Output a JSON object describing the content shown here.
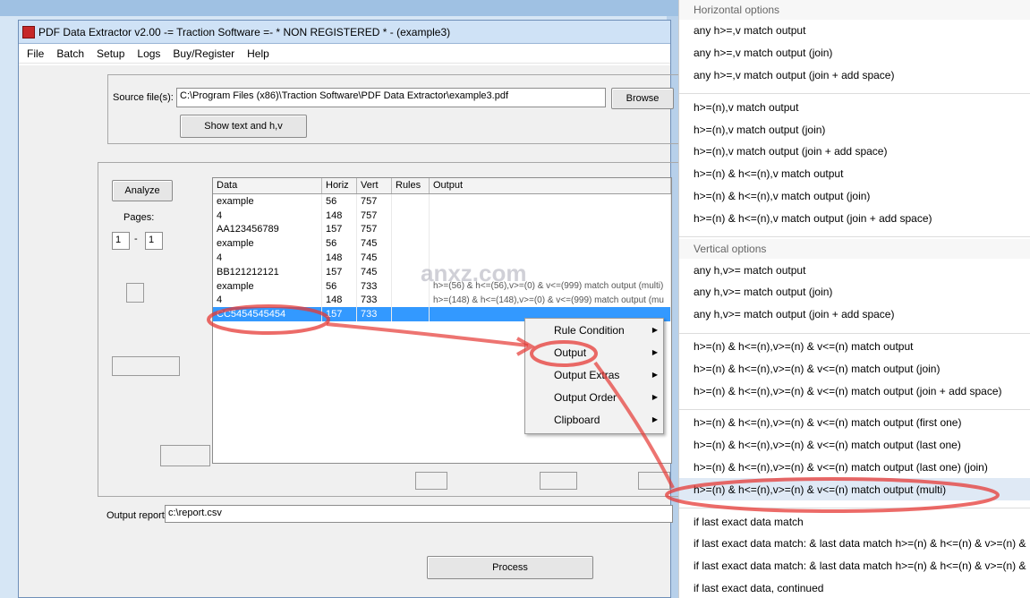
{
  "window": {
    "title": "PDF Data Extractor v2.00   -= Traction Software =- * NON REGISTERED * - (example3)"
  },
  "menu": [
    "File",
    "Batch",
    "Setup",
    "Logs",
    "Buy/Register",
    "Help"
  ],
  "source": {
    "label": "Source file(s):",
    "value": "C:\\Program Files (x86)\\Traction Software\\PDF Data Extractor\\example3.pdf",
    "browse": "Browse",
    "show_text": "Show text and h,v"
  },
  "analyze": {
    "button": "Analyze",
    "pages_label": "Pages:",
    "from": "1",
    "separator": "-",
    "to": "1"
  },
  "grid": {
    "headers": [
      "Data",
      "Horiz",
      "Vert",
      "Rules",
      "Output"
    ],
    "rows": [
      {
        "data": "example",
        "h": "56",
        "v": "757",
        "rules": "",
        "output": ""
      },
      {
        "data": "4",
        "h": "148",
        "v": "757",
        "rules": "",
        "output": ""
      },
      {
        "data": "AA123456789",
        "h": "157",
        "v": "757",
        "rules": "",
        "output": ""
      },
      {
        "data": "example",
        "h": "56",
        "v": "745",
        "rules": "",
        "output": ""
      },
      {
        "data": "4",
        "h": "148",
        "v": "745",
        "rules": "",
        "output": ""
      },
      {
        "data": "BB121212121",
        "h": "157",
        "v": "745",
        "rules": "",
        "output": ""
      },
      {
        "data": "example",
        "h": "56",
        "v": "733",
        "rules": "",
        "output": "h>=(56) & h<=(56),v>=(0) & v<=(999) match output (multi)"
      },
      {
        "data": "4",
        "h": "148",
        "v": "733",
        "rules": "",
        "output": "h>=(148) & h<=(148),v>=(0) & v<=(999) match output (mu"
      },
      {
        "data": "CC5454545454",
        "h": "157",
        "v": "733",
        "rules": "",
        "output": ""
      }
    ]
  },
  "context_menu": [
    "Rule Condition",
    "Output",
    "Output Extras",
    "Output Order",
    "Clipboard"
  ],
  "output_report": {
    "label": "Output report:",
    "value": "c:\\report.csv"
  },
  "process_button": "Process",
  "watermark": "anxz.com",
  "panel": {
    "horizontal_title": "Horizontal options",
    "horizontal": [
      "any h>=,v match output",
      "any h>=,v match output (join)",
      "any h>=,v match output (join + add space)"
    ],
    "horizontal2": [
      "h>=(n),v match output",
      "h>=(n),v match output (join)",
      "h>=(n),v match output (join + add space)",
      "h>=(n) & h<=(n),v match output",
      "h>=(n) & h<=(n),v match output (join)",
      "h>=(n) & h<=(n),v match output (join + add space)"
    ],
    "vertical_title": "Vertical options",
    "vertical": [
      "any h,v>= match output",
      "any h,v>= match output (join)",
      "any h,v>= match output (join + add space)"
    ],
    "combined": [
      "h>=(n) & h<=(n),v>=(n) & v<=(n) match output",
      "h>=(n) & h<=(n),v>=(n) & v<=(n) match output (join)",
      "h>=(n) & h<=(n),v>=(n) & v<=(n) match output (join + add space)"
    ],
    "combined2": [
      "h>=(n) & h<=(n),v>=(n) & v<=(n) match output (first one)",
      "h>=(n) & h<=(n),v>=(n) & v<=(n) match output (last one)",
      "h>=(n) & h<=(n),v>=(n) & v<=(n) match output (last one) (join)",
      "h>=(n) & h<=(n),v>=(n) & v<=(n) match output (multi)"
    ],
    "last": [
      "if last exact data match",
      "if last exact data match: & last data match h>=(n) & h<=(n) & v>=(n) &",
      "if last exact data match: & last data match h>=(n) & h<=(n) & v>=(n) &",
      "if last exact data, continued"
    ]
  },
  "colors": {
    "selection": "#3399ff",
    "annotation": "#e53935"
  }
}
